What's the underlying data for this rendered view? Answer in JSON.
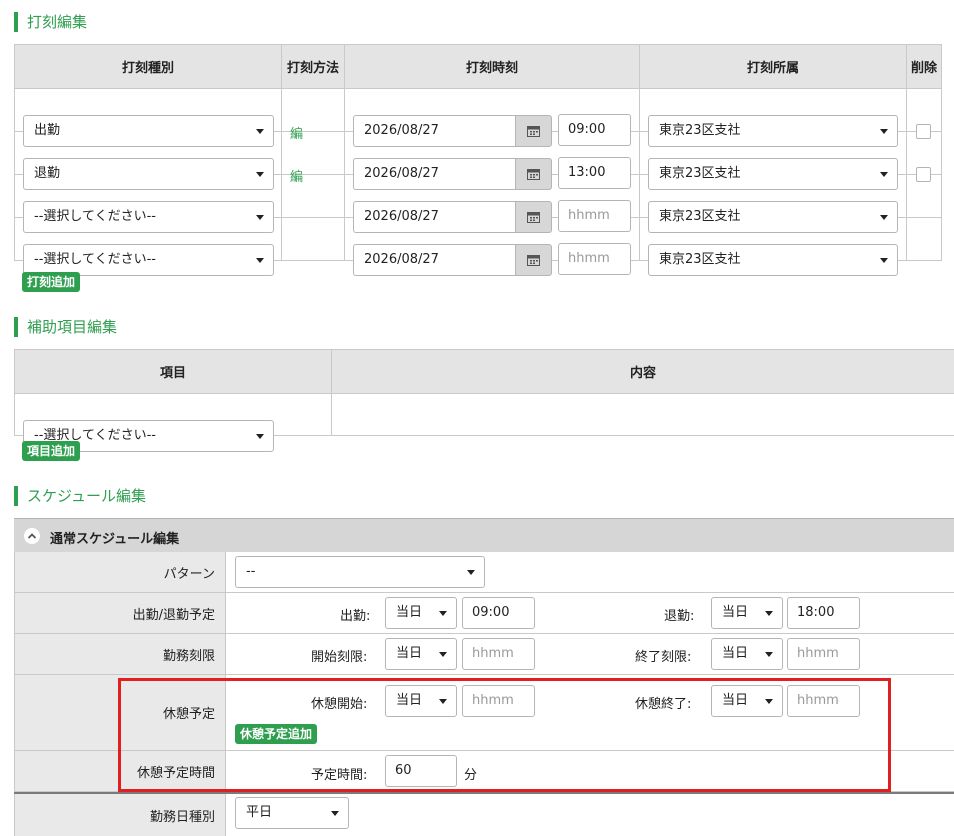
{
  "punch_section": {
    "title": "打刻編集",
    "headers": {
      "type": "打刻種別",
      "method": "打刻方法",
      "time": "打刻時刻",
      "affiliation": "打刻所属",
      "delete": "削除"
    },
    "rows": [
      {
        "type": "出勤",
        "method": "編",
        "date": "2026/08/27",
        "time": "09:00",
        "time_placeholder": "",
        "affiliation": "東京23区支社",
        "has_checkbox": true
      },
      {
        "type": "退勤",
        "method": "編",
        "date": "2026/08/27",
        "time": "13:00",
        "time_placeholder": "",
        "affiliation": "東京23区支社",
        "has_checkbox": true
      },
      {
        "type": "--選択してください--",
        "method": "",
        "date": "2026/08/27",
        "time": "",
        "time_placeholder": "hhmm",
        "affiliation": "東京23区支社",
        "has_checkbox": false
      },
      {
        "type": "--選択してください--",
        "method": "",
        "date": "2026/08/27",
        "time": "",
        "time_placeholder": "hhmm",
        "affiliation": "東京23区支社",
        "has_checkbox": false
      }
    ],
    "add_button": "打刻追加"
  },
  "aux_section": {
    "title": "補助項目編集",
    "headers": {
      "item": "項目",
      "content": "内容"
    },
    "row": {
      "item": "--選択してください--"
    },
    "add_button": "項目追加"
  },
  "schedule_section": {
    "title": "スケジュール編集",
    "panel_title": "通常スケジュール編集",
    "pattern": {
      "label": "パターン",
      "value": "--"
    },
    "attendance": {
      "label": "出勤/退勤予定",
      "start_label": "出勤:",
      "start_day": "当日",
      "start_time": "09:00",
      "end_label": "退勤:",
      "end_day": "当日",
      "end_time": "18:00"
    },
    "work_limit": {
      "label": "勤務刻限",
      "start_label": "開始刻限:",
      "start_day": "当日",
      "start_placeholder": "hhmm",
      "end_label": "終了刻限:",
      "end_day": "当日",
      "end_placeholder": "hhmm"
    },
    "break_plan": {
      "label": "休憩予定",
      "start_label": "休憩開始:",
      "start_day": "当日",
      "start_placeholder": "hhmm",
      "end_label": "休憩終了:",
      "end_day": "当日",
      "end_placeholder": "hhmm",
      "add_button": "休憩予定追加"
    },
    "break_time": {
      "label": "休憩予定時間",
      "field_label": "予定時間:",
      "value": "60",
      "unit": "分"
    },
    "work_day": {
      "label": "勤務日種別",
      "value": "平日"
    }
  },
  "colors": {
    "accent_green": "#2e9e4f",
    "highlight_red": "#e02020"
  }
}
